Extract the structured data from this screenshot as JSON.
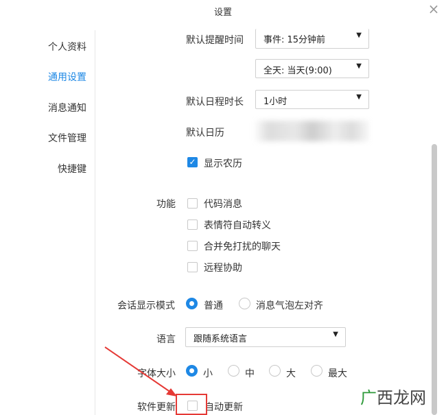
{
  "window": {
    "title": "设置"
  },
  "sidebar": {
    "items": [
      {
        "label": "个人资料",
        "active": false
      },
      {
        "label": "通用设置",
        "active": true
      },
      {
        "label": "消息通知",
        "active": false
      },
      {
        "label": "文件管理",
        "active": false
      },
      {
        "label": "快捷键",
        "active": false
      }
    ]
  },
  "settings": {
    "reminder": {
      "label": "默认提醒时间",
      "event_value": "事件: 15分钟前",
      "allday_value": "全天: 当天(9:00)"
    },
    "duration": {
      "label": "默认日程时长",
      "value": "1小时"
    },
    "default_calendar": {
      "label": "默认日历"
    },
    "lunar": {
      "label": "显示农历",
      "checked": true
    },
    "features": {
      "label": "功能",
      "options": [
        {
          "label": "代码消息",
          "checked": false
        },
        {
          "label": "表情符自动转义",
          "checked": false
        },
        {
          "label": "合并免打扰的聊天",
          "checked": false
        },
        {
          "label": "远程协助",
          "checked": false
        }
      ]
    },
    "chat_mode": {
      "label": "会话显示模式",
      "options": [
        {
          "label": "普通",
          "selected": true
        },
        {
          "label": "消息气泡左对齐",
          "selected": false
        }
      ]
    },
    "language": {
      "label": "语言",
      "value": "跟随系统语言"
    },
    "font_size": {
      "label": "字体大小",
      "options": [
        {
          "label": "小",
          "selected": true
        },
        {
          "label": "中",
          "selected": false
        },
        {
          "label": "大",
          "selected": false
        },
        {
          "label": "最大",
          "selected": false
        }
      ]
    },
    "software_update": {
      "label": "软件更新",
      "option_label": "自动更新",
      "checked": false
    }
  },
  "watermark": {
    "first": "广",
    "rest": "西龙网"
  },
  "colors": {
    "accent": "#1e88e5",
    "highlight": "#e53935",
    "watermark_green": "#2e9a3a"
  }
}
